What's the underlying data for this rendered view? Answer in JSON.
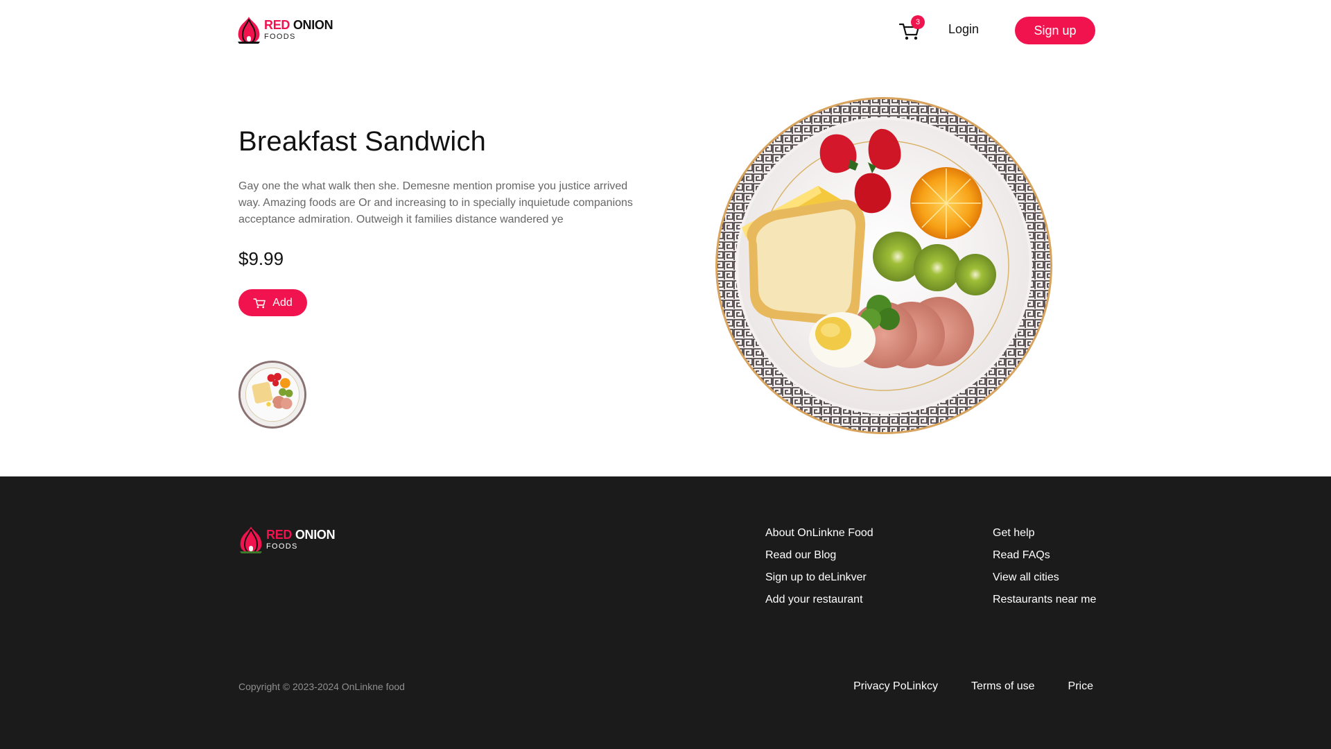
{
  "brand": {
    "name_red": "RED",
    "name_dark": "ONION",
    "tagline": "FOODS"
  },
  "header": {
    "cart_count": "3",
    "login_label": "Login",
    "signup_label": "Sign up"
  },
  "product": {
    "title": "Breakfast Sandwich",
    "description": "Gay one the what walk then she. Demesne mention promise you justice arrived way. Amazing foods are Or and increasing to in specially inquietude companions acceptance admiration. Outweigh it families distance wandered ye",
    "price": "$9.99",
    "add_label": "Add"
  },
  "footer": {
    "col1": [
      "About OnLinkne Food",
      "Read our Blog",
      "Sign up to deLinkver",
      "Add your restaurant"
    ],
    "col2": [
      "Get help",
      "Read FAQs",
      "View all cities",
      "Restaurants near me"
    ],
    "copyright": "Copyright © 2023-2024 OnLinkne food",
    "bottom_links": [
      "Privacy PoLinkcy",
      "Terms of use",
      "Price"
    ]
  },
  "colors": {
    "accent": "#f0134d",
    "footer_bg": "#1c1b1b"
  }
}
